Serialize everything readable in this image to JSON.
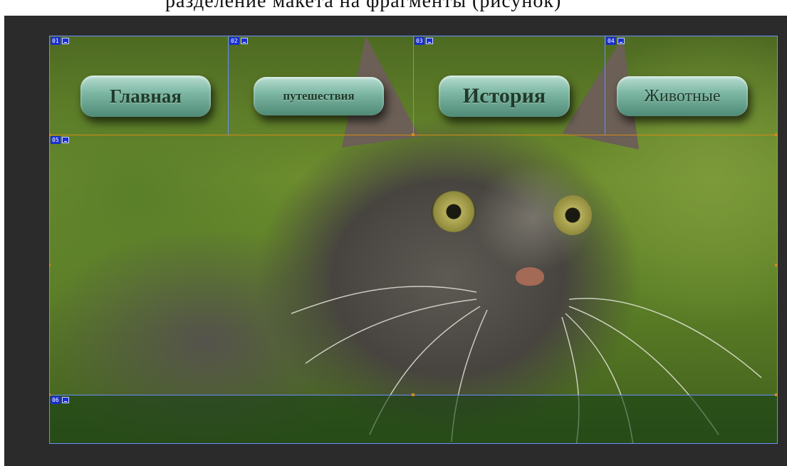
{
  "caption": {
    "text": "разделение макета на фрагменты (рисунок)"
  },
  "slices": [
    {
      "num": "01",
      "icon": "image-slice-icon"
    },
    {
      "num": "02",
      "icon": "image-slice-icon"
    },
    {
      "num": "03",
      "icon": "image-slice-icon"
    },
    {
      "num": "04",
      "icon": "image-slice-icon"
    },
    {
      "num": "05",
      "icon": "image-slice-icon"
    },
    {
      "num": "06",
      "icon": "image-slice-icon"
    }
  ],
  "nav": {
    "home": "Главная",
    "travel": "путешествия",
    "history": "История",
    "animals": "Животные"
  },
  "colors": {
    "workspace": "#2b2b2b",
    "slice_guide": "#6a8cff",
    "slice_guide_active": "#d48a1a",
    "slice_tag": "#1a2fd0",
    "button_text": "#1f3a2a"
  }
}
